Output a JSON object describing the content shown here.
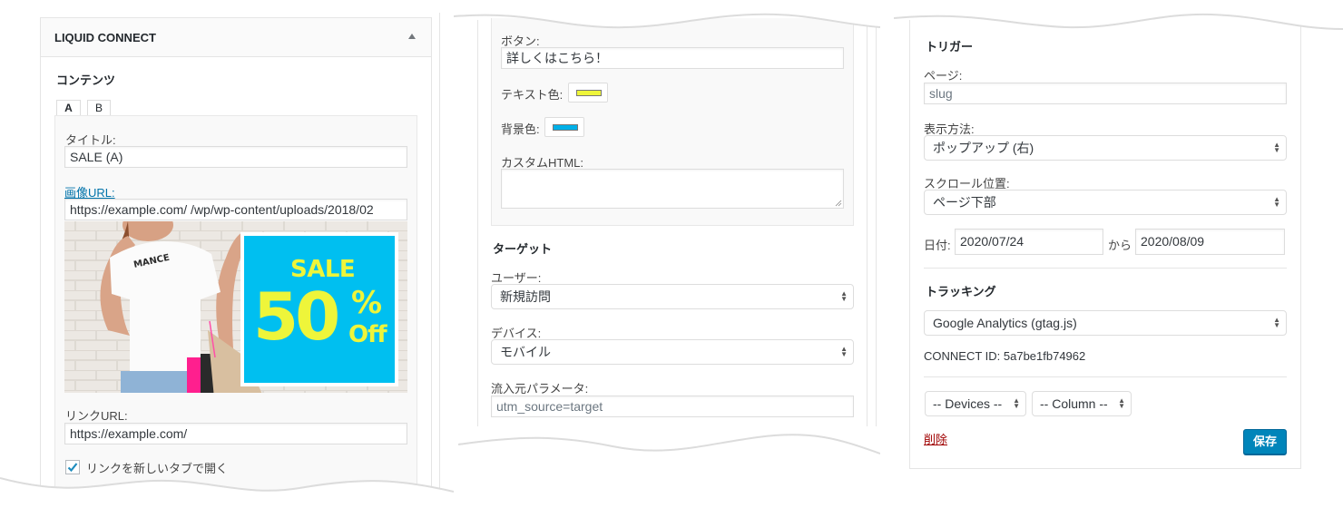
{
  "panel1": {
    "title": "LIQUID CONNECT",
    "toggle_icon": "triangle-up-icon",
    "contents_heading": "コンテンツ",
    "tabs": [
      {
        "label": "A",
        "active": true
      },
      {
        "label": "B",
        "active": false
      }
    ],
    "title_label": "タイトル:",
    "title_value": "SALE (A)",
    "image_url_label": "画像URL:",
    "image_url_value": "https://example.com/  /wp/wp-content/uploads/2018/02",
    "banner": {
      "sale_text": "SALE",
      "percent_text": "50",
      "percent_sign": "%",
      "off_text": "Off",
      "shirt_text": "MANCE",
      "bg_color": "#00bff0",
      "text_color": "#eef53a"
    },
    "link_url_label": "リンクURL:",
    "link_url_value": "https://example.com/",
    "new_tab_label": "リンクを新しいタブで開く",
    "new_tab_checked": true
  },
  "panel2": {
    "button_label": "ボタン:",
    "button_value": "詳しくはこちら！",
    "text_color_label": "テキスト色:",
    "text_color": "#eef53a",
    "bg_color_label": "背景色:",
    "bg_color": "#00b0e8",
    "custom_html_label": "カスタムHTML:",
    "custom_html_value": "",
    "target_heading": "ターゲット",
    "user_label": "ユーザー:",
    "user_value": "新規訪問",
    "device_label": "デバイス:",
    "device_value": "モバイル",
    "source_param_label": "流入元パラメータ:",
    "source_param_value": "utm_source=target"
  },
  "panel3": {
    "trigger_heading": "トリガー",
    "page_label": "ページ:",
    "page_value": "slug",
    "display_method_label": "表示方法:",
    "display_method_value": "ポップアップ (右)",
    "scroll_position_label": "スクロール位置:",
    "scroll_position_value": "ページ下部",
    "date_label": "日付:",
    "date_from": "2020/07/24",
    "date_separator": "から",
    "date_to": "2020/08/09",
    "tracking_heading": "トラッキング",
    "tracking_value": "Google Analytics (gtag.js)",
    "connect_id_text": "CONNECT ID: 5a7be1fb74962",
    "devices_select": "-- Devices --",
    "column_select": "-- Column --",
    "delete_link": "削除",
    "save_button": "保存",
    "delete_color": "#a00000",
    "save_color": "#0085ba"
  }
}
